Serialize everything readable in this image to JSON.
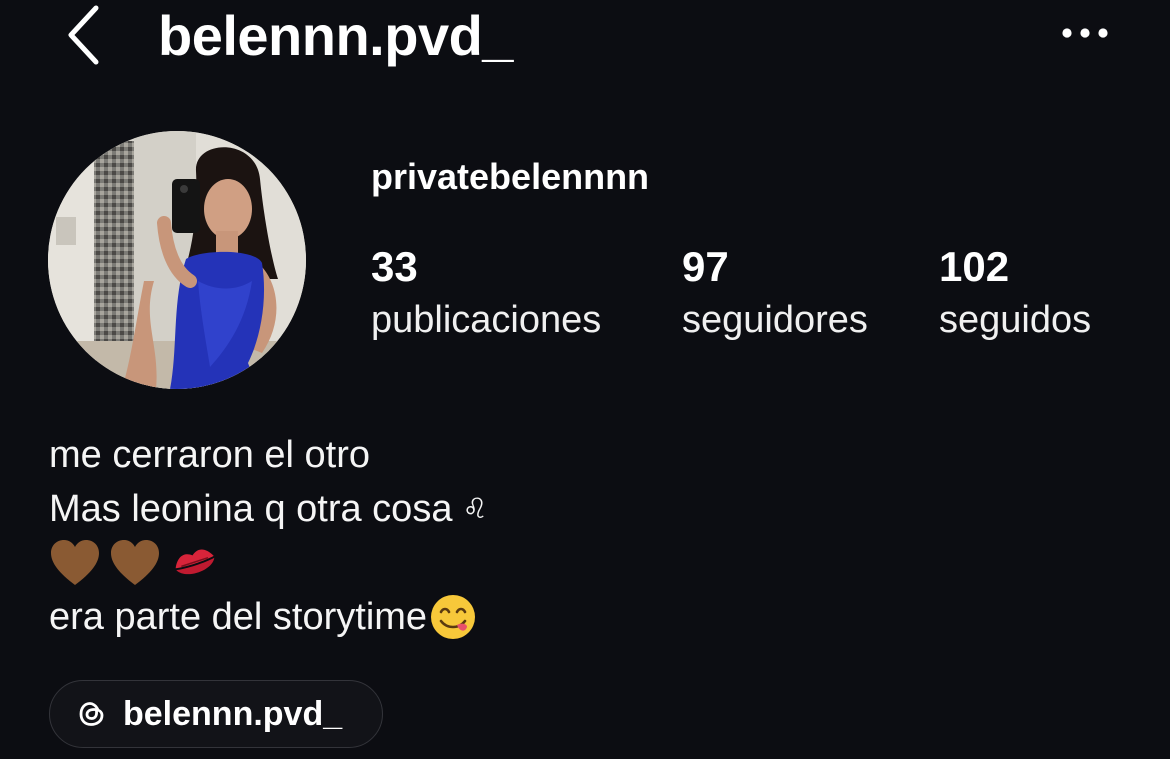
{
  "header": {
    "username": "belennn.pvd_",
    "back_icon": "chevron-left-icon",
    "more_icon": "more-horizontal-icon"
  },
  "profile": {
    "display_name": "privatebelennnn",
    "avatar_icon": "profile-photo"
  },
  "stats": [
    {
      "value": "33",
      "label": "publicaciones"
    },
    {
      "value": "97",
      "label": "seguidores"
    },
    {
      "value": "102",
      "label": "seguidos"
    }
  ],
  "bio": {
    "line1": "me cerraron el otro",
    "line2": "Mas leonina q otra cosa",
    "line2_symbol": "♌",
    "line4": "era parte del storytime",
    "emojis": [
      "brown-heart-emoji",
      "brown-heart-emoji",
      "kiss-mark-emoji",
      "savoring-face-emoji"
    ]
  },
  "threads": {
    "handle": "belennn.pvd_",
    "icon": "threads-icon"
  },
  "colors": {
    "background": "#0c0d12",
    "text": "#ffffff",
    "brown_heart": "#8a5a33",
    "dress_blue": "#2433b8"
  }
}
